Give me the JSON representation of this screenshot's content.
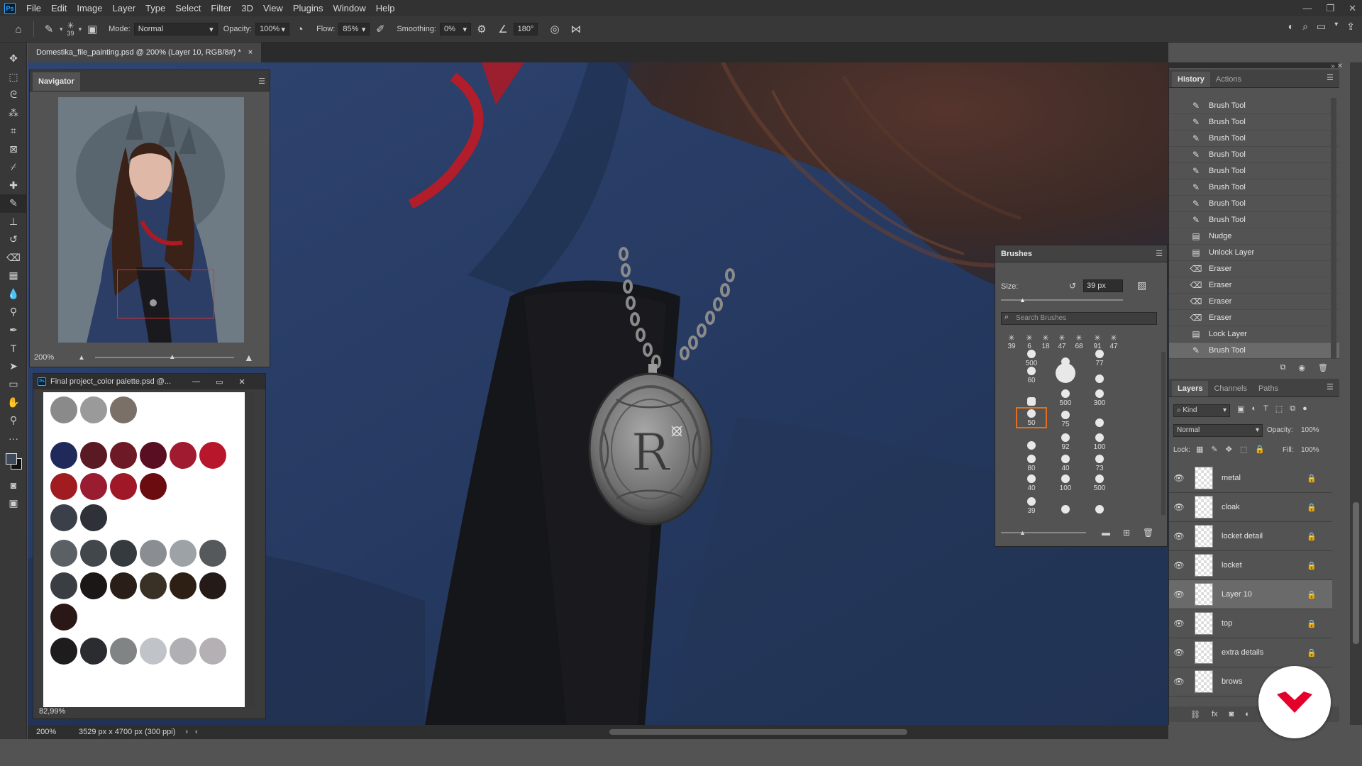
{
  "menu": {
    "logo": "Ps",
    "items": [
      "File",
      "Edit",
      "Image",
      "Layer",
      "Type",
      "Select",
      "Filter",
      "3D",
      "View",
      "Plugins",
      "Window",
      "Help"
    ]
  },
  "options": {
    "brush_size": "39",
    "mode_label": "Mode:",
    "mode_value": "Normal",
    "opacity_label": "Opacity:",
    "opacity_value": "100%",
    "flow_label": "Flow:",
    "flow_value": "85%",
    "smoothing_label": "Smoothing:",
    "smoothing_value": "0%",
    "angle_value": "180°"
  },
  "doc_tab": {
    "title": "Domestika_file_painting.psd @ 200% (Layer 10, RGB/8#) *",
    "close": "×"
  },
  "navigator": {
    "title": "Navigator",
    "zoom": "200%"
  },
  "palette_window": {
    "title": "Final project_color palette.psd @...",
    "zoom": "82,99%",
    "colors": [
      [
        "#8a8a8a",
        "#9a9a9a",
        "#7a7068"
      ],
      [
        "#1f2a5a",
        "#5a1a24",
        "#6e1a26",
        "#5a0e22",
        "#a01a30",
        "#b8162a"
      ],
      [
        "#a01c20",
        "#9a1c30",
        "#a01828",
        "#6a0c10"
      ],
      [
        "#3a3f4a",
        "#2e3238"
      ],
      [
        "#5a6064",
        "#42474c",
        "#353a3e",
        "#8a8e92",
        "#9ca2a6",
        "#55595c"
      ],
      [
        "#3a3e42",
        "#1a1716",
        "#2a1f18",
        "#3a3126",
        "#2e1f14",
        "#241a18"
      ],
      [
        "#2a1816"
      ],
      [
        "#1e1c1c",
        "#2a2c30",
        "#808484",
        "#c0c4c8",
        "#b0b0b4",
        "#b4b0b4"
      ]
    ]
  },
  "brushes": {
    "title": "Brushes",
    "size_label": "Size:",
    "size_value": "39 px",
    "search_placeholder": "Search Brushes",
    "recent": [
      "39",
      "6",
      "18",
      "47",
      "68",
      "91",
      "47"
    ],
    "grid": [
      [
        "500",
        "",
        "77"
      ],
      [
        "60",
        "",
        ""
      ],
      [
        "",
        "500",
        "300"
      ],
      [
        "50",
        "75",
        ""
      ],
      [
        "",
        "92",
        "100"
      ],
      [
        "80",
        "40",
        "73"
      ],
      [
        "40",
        "100",
        "500"
      ],
      [
        "39",
        "",
        ""
      ]
    ]
  },
  "history": {
    "tabs": [
      "History",
      "Actions"
    ],
    "items": [
      {
        "label": "Brush Tool",
        "icon": "brush-icon"
      },
      {
        "label": "Brush Tool",
        "icon": "brush-icon"
      },
      {
        "label": "Brush Tool",
        "icon": "brush-icon"
      },
      {
        "label": "Brush Tool",
        "icon": "brush-icon"
      },
      {
        "label": "Brush Tool",
        "icon": "brush-icon"
      },
      {
        "label": "Brush Tool",
        "icon": "brush-icon"
      },
      {
        "label": "Brush Tool",
        "icon": "brush-icon"
      },
      {
        "label": "Brush Tool",
        "icon": "brush-icon"
      },
      {
        "label": "Nudge",
        "icon": "doc-icon"
      },
      {
        "label": "Unlock Layer",
        "icon": "doc-icon"
      },
      {
        "label": "Eraser",
        "icon": "eraser-icon"
      },
      {
        "label": "Eraser",
        "icon": "eraser-icon"
      },
      {
        "label": "Eraser",
        "icon": "eraser-icon"
      },
      {
        "label": "Eraser",
        "icon": "eraser-icon"
      },
      {
        "label": "Lock Layer",
        "icon": "doc-icon"
      },
      {
        "label": "Brush Tool",
        "icon": "brush-icon"
      }
    ]
  },
  "layers": {
    "tabs": [
      "Layers",
      "Channels",
      "Paths"
    ],
    "kind_label": "Kind",
    "blend": "Normal",
    "opacity_label": "Opacity:",
    "opacity_value": "100%",
    "lock_label": "Lock:",
    "fill_label": "Fill:",
    "fill_value": "100%",
    "items": [
      {
        "name": "metal"
      },
      {
        "name": "cloak"
      },
      {
        "name": "locket detail"
      },
      {
        "name": "locket"
      },
      {
        "name": "Layer 10"
      },
      {
        "name": "top"
      },
      {
        "name": "extra details"
      },
      {
        "name": "brows"
      }
    ]
  },
  "status": {
    "zoom": "200%",
    "doc_info": "3529 px x 4700 px (300 ppi)"
  },
  "colors": {
    "accent_selection": "#e07020",
    "canvas_blue": "#2a3d63",
    "brand_red": "#e4002b"
  }
}
